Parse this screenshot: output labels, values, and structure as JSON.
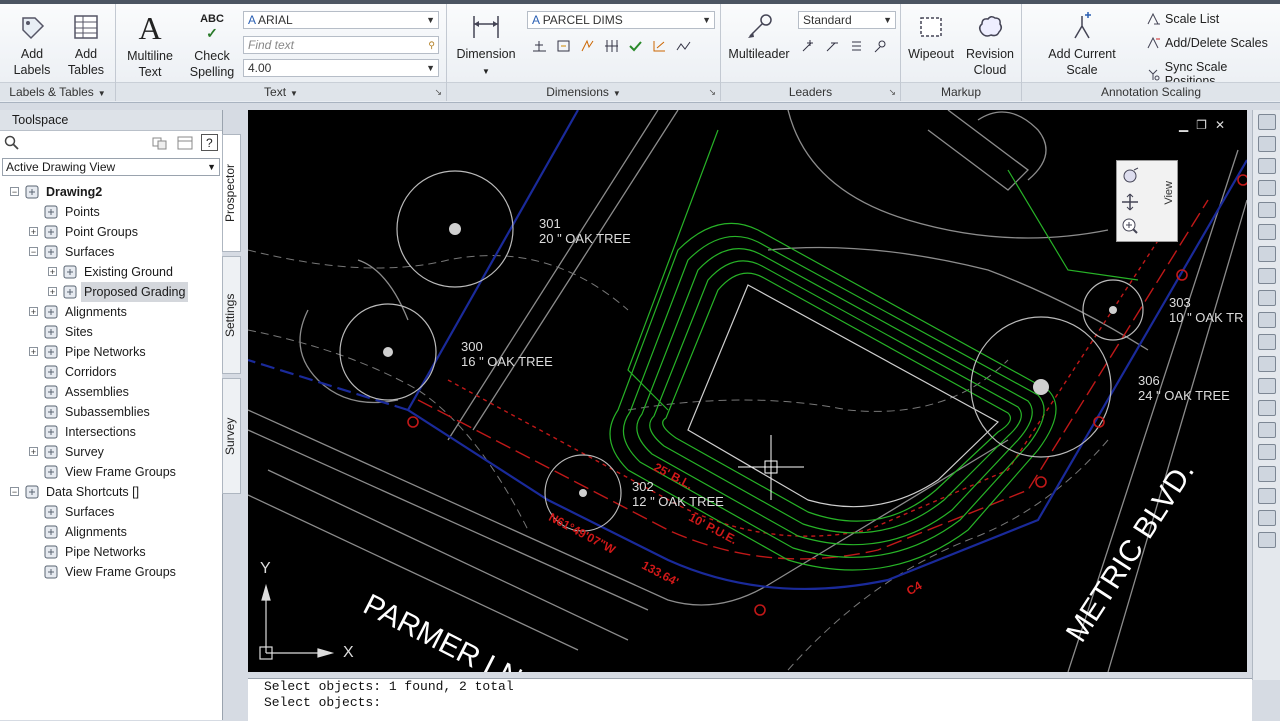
{
  "ribbon": {
    "panels": {
      "labels_tables": {
        "title": "Labels & Tables",
        "add_labels": "Add\nLabels",
        "add_tables": "Add\nTables"
      },
      "text": {
        "title": "Text",
        "multiline_text": "Multiline\nText",
        "check_spelling": "Check\nSpelling",
        "font": "ARIAL",
        "find_text_placeholder": "Find text",
        "text_height": "4.00",
        "abc": "ABC"
      },
      "dimensions": {
        "title": "Dimensions",
        "dimension": "Dimension",
        "dim_style": "PARCEL DIMS"
      },
      "leaders": {
        "title": "Leaders",
        "multileader": "Multileader",
        "leader_style": "Standard"
      },
      "markup": {
        "title": "Markup",
        "wipeout": "Wipeout",
        "revision_cloud": "Revision\nCloud"
      },
      "annotation_scaling": {
        "title": "Annotation Scaling",
        "add_current_scale": "Add Current Scale",
        "scale_list": "Scale List",
        "add_delete_scales": "Add/Delete Scales",
        "sync_scale_positions": "Sync Scale Positions"
      }
    }
  },
  "toolspace": {
    "title": "Toolspace",
    "view_select": "Active Drawing View",
    "tabs": [
      "Prospector",
      "Settings",
      "Survey"
    ],
    "tree": [
      {
        "label": "Drawing2",
        "icon": "drawing-icon",
        "bold": true
      },
      {
        "label": "Points",
        "icon": "points-icon"
      },
      {
        "label": "Point Groups",
        "icon": "point-groups-icon"
      },
      {
        "label": "Surfaces",
        "icon": "surfaces-icon"
      },
      {
        "label": "Existing Ground",
        "icon": "surface-icon"
      },
      {
        "label": "Proposed Grading",
        "icon": "surface-icon",
        "selected": true
      },
      {
        "label": "Alignments",
        "icon": "alignments-icon"
      },
      {
        "label": "Sites",
        "icon": "sites-icon"
      },
      {
        "label": "Pipe Networks",
        "icon": "pipe-networks-icon"
      },
      {
        "label": "Corridors",
        "icon": "corridors-icon"
      },
      {
        "label": "Assemblies",
        "icon": "assemblies-icon"
      },
      {
        "label": "Subassemblies",
        "icon": "subassemblies-icon"
      },
      {
        "label": "Intersections",
        "icon": "intersections-icon"
      },
      {
        "label": "Survey",
        "icon": "survey-icon"
      },
      {
        "label": "View Frame Groups",
        "icon": "view-frame-groups-icon"
      },
      {
        "label": "Data Shortcuts []",
        "icon": "data-shortcuts-icon"
      },
      {
        "label": "Surfaces",
        "icon": "surfaces-icon"
      },
      {
        "label": "Alignments",
        "icon": "alignments-icon"
      },
      {
        "label": "Pipe Networks",
        "icon": "pipe-networks-icon"
      },
      {
        "label": "View Frame Groups",
        "icon": "view-frame-groups-icon"
      }
    ]
  },
  "drawing": {
    "labels": {
      "tree_301": "301",
      "tree_301_desc": "20 \" OAK TREE",
      "tree_300": "300",
      "tree_300_desc": "16 \" OAK TREE",
      "tree_302": "302",
      "tree_302_desc": "12 \" OAK TREE",
      "tree_303": "303",
      "tree_303_desc": "10 \" OAK TR",
      "tree_306": "306",
      "tree_306_desc": "24 \" OAK TREE",
      "street_parmer": "PARMER LN",
      "street_metric": "METRIC BLVD.",
      "bl_label": "25' B.L.",
      "pue_label": "10' P.U.E.",
      "bearing_label": "N61°49'07\"W",
      "dist_label": "133.64'",
      "curve_label": "C4",
      "ucs_x": "X",
      "ucs_y": "Y",
      "viewcube_tab": "View"
    }
  },
  "command_line": {
    "lines": [
      "Select objects: 1 found, 2 total",
      "Select objects:"
    ]
  }
}
